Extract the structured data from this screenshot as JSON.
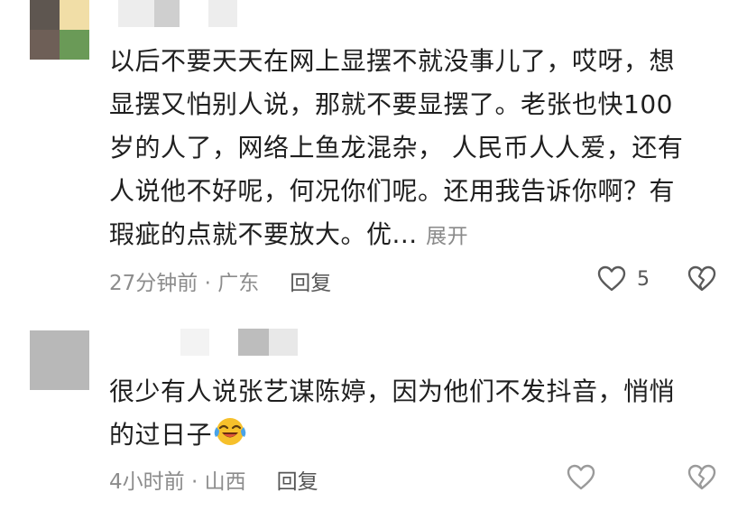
{
  "comments": [
    {
      "text_lines": [
        "以后不要天天在网上显摆不就没事儿了，哎呀，想",
        "显摆又怕别人说，那就不要显摆了。老张也快100",
        "岁的人了，网络上鱼龙混杂， 人民币人人爱，还有",
        "人说他不好呢，何况你们呢。还用我告诉你啊？有",
        "瑕疵的点就不要放大。优..."
      ],
      "expand_label": "展开",
      "time": "27分钟前",
      "location": "广东",
      "reply_label": "回复",
      "like_count": "5",
      "avatar_colors": [
        "#5e5650",
        "#f1dea7",
        "#6e5f57",
        "#6a9a57"
      ]
    },
    {
      "text_lines": [
        "很少有人说张艺谋陈婷，因为他们不发抖音，悄悄",
        "的过日子"
      ],
      "emoji": "crying-laughing-emoji",
      "time": "4小时前",
      "location": "山西",
      "reply_label": "回复",
      "avatar_colors": [
        "#b8b8b8"
      ]
    }
  ],
  "separator": "·",
  "icons": {
    "like": "heart-outline-icon",
    "dislike": "broken-heart-icon"
  },
  "colors": {
    "text": "#1f1f1f",
    "meta": "#8c8c8c",
    "reply": "#555555"
  }
}
